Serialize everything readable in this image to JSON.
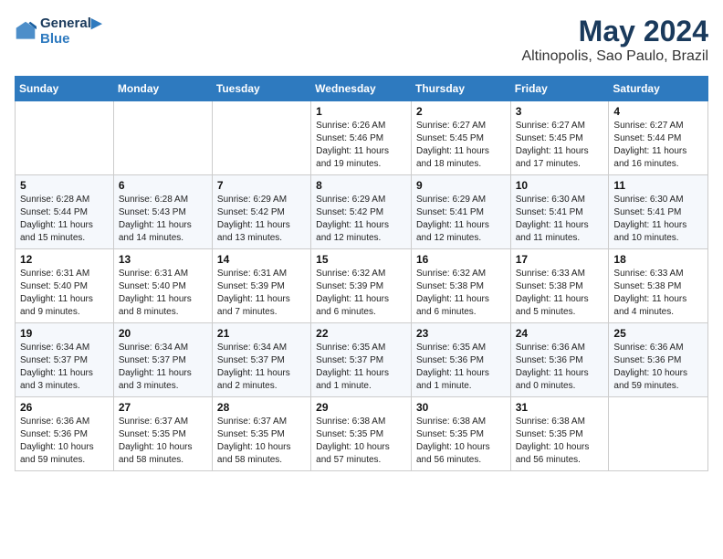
{
  "header": {
    "logo_line1": "General",
    "logo_line2": "Blue",
    "month_title": "May 2024",
    "location": "Altinopolis, Sao Paulo, Brazil"
  },
  "weekdays": [
    "Sunday",
    "Monday",
    "Tuesday",
    "Wednesday",
    "Thursday",
    "Friday",
    "Saturday"
  ],
  "weeks": [
    [
      {
        "day": "",
        "info": ""
      },
      {
        "day": "",
        "info": ""
      },
      {
        "day": "",
        "info": ""
      },
      {
        "day": "1",
        "info": "Sunrise: 6:26 AM\nSunset: 5:46 PM\nDaylight: 11 hours\nand 19 minutes."
      },
      {
        "day": "2",
        "info": "Sunrise: 6:27 AM\nSunset: 5:45 PM\nDaylight: 11 hours\nand 18 minutes."
      },
      {
        "day": "3",
        "info": "Sunrise: 6:27 AM\nSunset: 5:45 PM\nDaylight: 11 hours\nand 17 minutes."
      },
      {
        "day": "4",
        "info": "Sunrise: 6:27 AM\nSunset: 5:44 PM\nDaylight: 11 hours\nand 16 minutes."
      }
    ],
    [
      {
        "day": "5",
        "info": "Sunrise: 6:28 AM\nSunset: 5:44 PM\nDaylight: 11 hours\nand 15 minutes."
      },
      {
        "day": "6",
        "info": "Sunrise: 6:28 AM\nSunset: 5:43 PM\nDaylight: 11 hours\nand 14 minutes."
      },
      {
        "day": "7",
        "info": "Sunrise: 6:29 AM\nSunset: 5:42 PM\nDaylight: 11 hours\nand 13 minutes."
      },
      {
        "day": "8",
        "info": "Sunrise: 6:29 AM\nSunset: 5:42 PM\nDaylight: 11 hours\nand 12 minutes."
      },
      {
        "day": "9",
        "info": "Sunrise: 6:29 AM\nSunset: 5:41 PM\nDaylight: 11 hours\nand 12 minutes."
      },
      {
        "day": "10",
        "info": "Sunrise: 6:30 AM\nSunset: 5:41 PM\nDaylight: 11 hours\nand 11 minutes."
      },
      {
        "day": "11",
        "info": "Sunrise: 6:30 AM\nSunset: 5:41 PM\nDaylight: 11 hours\nand 10 minutes."
      }
    ],
    [
      {
        "day": "12",
        "info": "Sunrise: 6:31 AM\nSunset: 5:40 PM\nDaylight: 11 hours\nand 9 minutes."
      },
      {
        "day": "13",
        "info": "Sunrise: 6:31 AM\nSunset: 5:40 PM\nDaylight: 11 hours\nand 8 minutes."
      },
      {
        "day": "14",
        "info": "Sunrise: 6:31 AM\nSunset: 5:39 PM\nDaylight: 11 hours\nand 7 minutes."
      },
      {
        "day": "15",
        "info": "Sunrise: 6:32 AM\nSunset: 5:39 PM\nDaylight: 11 hours\nand 6 minutes."
      },
      {
        "day": "16",
        "info": "Sunrise: 6:32 AM\nSunset: 5:38 PM\nDaylight: 11 hours\nand 6 minutes."
      },
      {
        "day": "17",
        "info": "Sunrise: 6:33 AM\nSunset: 5:38 PM\nDaylight: 11 hours\nand 5 minutes."
      },
      {
        "day": "18",
        "info": "Sunrise: 6:33 AM\nSunset: 5:38 PM\nDaylight: 11 hours\nand 4 minutes."
      }
    ],
    [
      {
        "day": "19",
        "info": "Sunrise: 6:34 AM\nSunset: 5:37 PM\nDaylight: 11 hours\nand 3 minutes."
      },
      {
        "day": "20",
        "info": "Sunrise: 6:34 AM\nSunset: 5:37 PM\nDaylight: 11 hours\nand 3 minutes."
      },
      {
        "day": "21",
        "info": "Sunrise: 6:34 AM\nSunset: 5:37 PM\nDaylight: 11 hours\nand 2 minutes."
      },
      {
        "day": "22",
        "info": "Sunrise: 6:35 AM\nSunset: 5:37 PM\nDaylight: 11 hours\nand 1 minute."
      },
      {
        "day": "23",
        "info": "Sunrise: 6:35 AM\nSunset: 5:36 PM\nDaylight: 11 hours\nand 1 minute."
      },
      {
        "day": "24",
        "info": "Sunrise: 6:36 AM\nSunset: 5:36 PM\nDaylight: 11 hours\nand 0 minutes."
      },
      {
        "day": "25",
        "info": "Sunrise: 6:36 AM\nSunset: 5:36 PM\nDaylight: 10 hours\nand 59 minutes."
      }
    ],
    [
      {
        "day": "26",
        "info": "Sunrise: 6:36 AM\nSunset: 5:36 PM\nDaylight: 10 hours\nand 59 minutes."
      },
      {
        "day": "27",
        "info": "Sunrise: 6:37 AM\nSunset: 5:35 PM\nDaylight: 10 hours\nand 58 minutes."
      },
      {
        "day": "28",
        "info": "Sunrise: 6:37 AM\nSunset: 5:35 PM\nDaylight: 10 hours\nand 58 minutes."
      },
      {
        "day": "29",
        "info": "Sunrise: 6:38 AM\nSunset: 5:35 PM\nDaylight: 10 hours\nand 57 minutes."
      },
      {
        "day": "30",
        "info": "Sunrise: 6:38 AM\nSunset: 5:35 PM\nDaylight: 10 hours\nand 56 minutes."
      },
      {
        "day": "31",
        "info": "Sunrise: 6:38 AM\nSunset: 5:35 PM\nDaylight: 10 hours\nand 56 minutes."
      },
      {
        "day": "",
        "info": ""
      }
    ]
  ]
}
